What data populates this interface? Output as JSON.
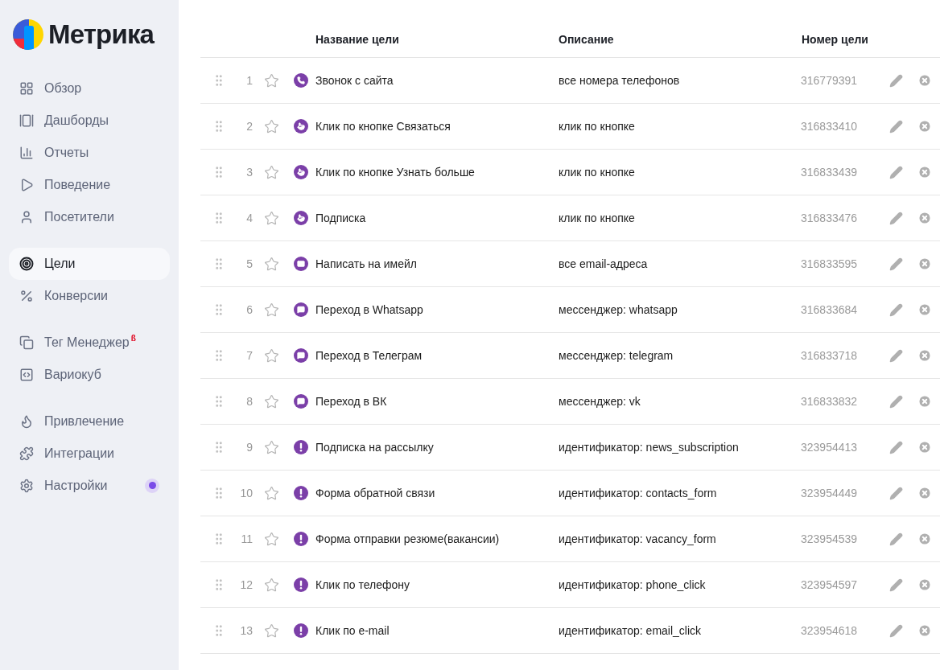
{
  "logo": {
    "text": "Метрика"
  },
  "sidebar": {
    "groups": [
      {
        "items": [
          {
            "label": "Обзор",
            "selected": false
          },
          {
            "label": "Дашборды",
            "selected": false
          },
          {
            "label": "Отчеты",
            "selected": false
          },
          {
            "label": "Поведение",
            "selected": false
          },
          {
            "label": "Посетители",
            "selected": false
          }
        ]
      },
      {
        "items": [
          {
            "label": "Цели",
            "selected": true
          },
          {
            "label": "Конверсии",
            "selected": false
          }
        ]
      },
      {
        "items": [
          {
            "label": "Тег Менеджер",
            "badge": "ß",
            "selected": false
          },
          {
            "label": "Вариокуб",
            "selected": false
          }
        ]
      },
      {
        "items": [
          {
            "label": "Привлечение",
            "selected": false
          },
          {
            "label": "Интеграции",
            "selected": false
          },
          {
            "label": "Настройки",
            "selected": false,
            "notification": true
          }
        ]
      }
    ]
  },
  "table": {
    "columns": [
      "Название цели",
      "Описание",
      "Номер цели"
    ],
    "rows": [
      {
        "index": "1",
        "starred": false,
        "kind": "phone",
        "name": "Звонок с сайта",
        "description": "все номера телефонов",
        "id": "316779391"
      },
      {
        "index": "2",
        "starred": false,
        "kind": "click",
        "name": "Клик по кнопке Связаться",
        "description": "клик по кнопке",
        "id": "316833410"
      },
      {
        "index": "3",
        "starred": false,
        "kind": "click",
        "name": "Клик по кнопке Узнать больше",
        "description": "клик по кнопке",
        "id": "316833439"
      },
      {
        "index": "4",
        "starred": false,
        "kind": "click",
        "name": "Подписка",
        "description": "клик по кнопке",
        "id": "316833476"
      },
      {
        "index": "5",
        "starred": false,
        "kind": "email",
        "name": "Написать на имейл",
        "description": "все email-адреса",
        "id": "316833595"
      },
      {
        "index": "6",
        "starred": false,
        "kind": "messenger",
        "name": "Переход в Whatsapp",
        "description": "мессенджер: whatsapp",
        "id": "316833684"
      },
      {
        "index": "7",
        "starred": false,
        "kind": "messenger",
        "name": "Переход в Телеграм",
        "description": "мессенджер: telegram",
        "id": "316833718"
      },
      {
        "index": "8",
        "starred": false,
        "kind": "messenger",
        "name": "Переход в ВК",
        "description": "мессенджер: vk",
        "id": "316833832"
      },
      {
        "index": "9",
        "starred": false,
        "kind": "identifier",
        "name": "Подписка на рассылку",
        "description": "идентификатор: news_subscription",
        "id": "323954413"
      },
      {
        "index": "10",
        "starred": false,
        "kind": "identifier",
        "name": "Форма обратной связи",
        "description": "идентификатор: contacts_form",
        "id": "323954449"
      },
      {
        "index": "11",
        "starred": false,
        "kind": "identifier",
        "name": "Форма отправки резюме(вакансии)",
        "description": "идентификатор: vacancy_form",
        "id": "323954539"
      },
      {
        "index": "12",
        "starred": false,
        "kind": "identifier",
        "name": "Клик по телефону",
        "description": "идентификатор: phone_click",
        "id": "323954597"
      },
      {
        "index": "13",
        "starred": false,
        "kind": "identifier",
        "name": "Клик по e-mail",
        "description": "идентификатор: email_click",
        "id": "323954618"
      }
    ]
  }
}
